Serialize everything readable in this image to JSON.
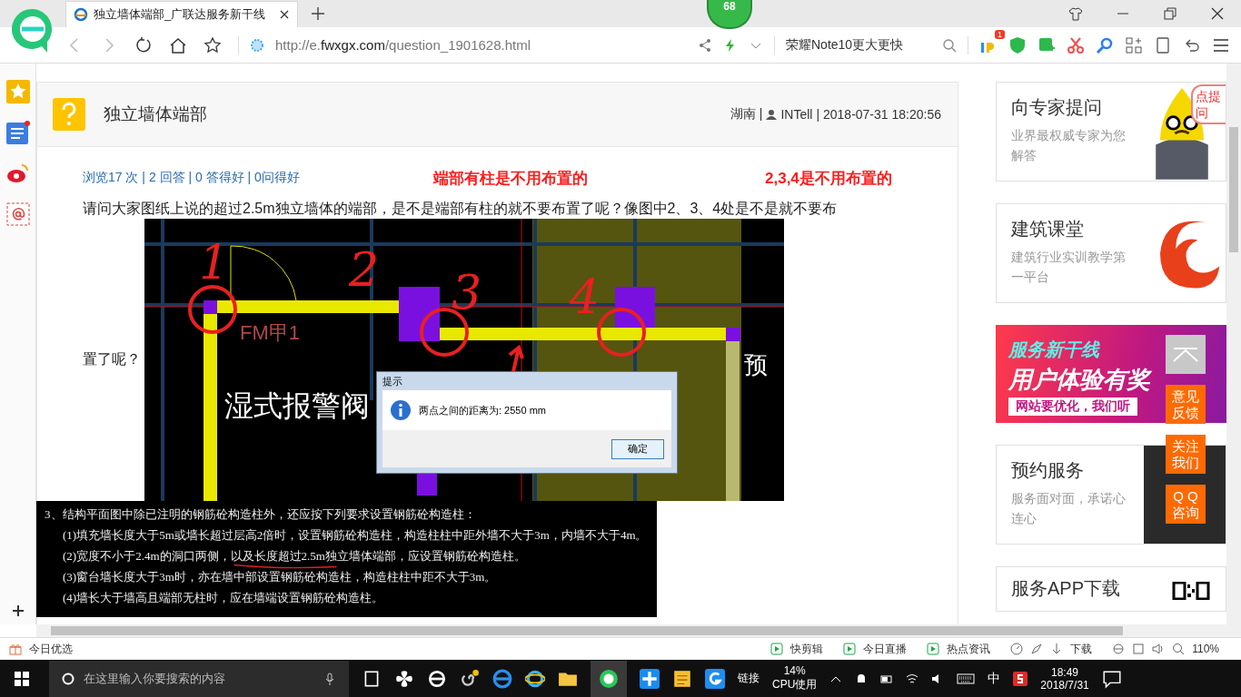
{
  "browser": {
    "badge": "68",
    "tab_title": "独立墙体端部_广联达服务新干线",
    "url_prefix": "http://e.",
    "url_domain": "fwxgx.com",
    "url_path": "/question_1901628.html",
    "search_text": "荣耀Note10更大更快",
    "notification_count": "1"
  },
  "question": {
    "title": "独立墙体端部",
    "location": "湖南 |",
    "user": "INTell",
    "time": "| 2018-07-31 18:20:56",
    "stats": "浏览17 次 | 2 回答 | 0 答得好 | 0问得好",
    "notes": [
      "端部有柱是不用布置的",
      "2,3,4是不用布置的"
    ],
    "text": [
      "请问大家图纸上说的超过2.5m独立墙体的端部，是不是端部有柱的就不要布置了呢？像图中2、3、4处是不是就不要布",
      "置了呢？"
    ],
    "cad": {
      "marks": [
        "1",
        "2",
        "3",
        "4"
      ],
      "labels": [
        "FM甲1",
        "湿式报警阀",
        "预"
      ],
      "dialog": {
        "title": "提示",
        "message": "两点之间的距离为: 2550 mm",
        "button": "确定"
      }
    },
    "spec_lines": [
      "3、结构平面图中除已注明的钢筋砼构造柱外，还应按下列要求设置钢筋砼构造柱：",
      "(1)填充墙长度大于5m或墙长超过层高2倍时，设置钢筋砼构造柱，构造柱柱中距外墙不大于3m，内墙不大于4m。",
      "(2)宽度不小于2.4m的洞口两侧，以及长度超过2.5m独立墙体端部，应设置钢筋砼构造柱。",
      "(3)窗台墙长度大于3m时，亦在墙中部设置钢筋砼构造柱，构造柱柱中距不大于3m。",
      "(4)墙长大于墙高且端部无柱时，应在墙端设置钢筋砼构造柱。"
    ]
  },
  "right_column": {
    "cards": [
      {
        "kind": "mascot",
        "title": "向专家提问",
        "subtitle": "业界最权威专家为您解答",
        "bubble": "点提问"
      },
      {
        "kind": "logo",
        "title": "建筑课堂",
        "subtitle": "建筑行业实训教学第一平台"
      },
      {
        "kind": "banner",
        "title": "服务新干线",
        "subtitle": "用户体验有奖",
        "bubble": "网站要优化，我们听"
      },
      {
        "kind": "photo",
        "title": "预约服务",
        "subtitle": "服务面对面，承诺心连心"
      },
      {
        "kind": "qr",
        "title": "服务APP下载"
      }
    ]
  },
  "float_buttons": [
    {
      "kind": "top"
    },
    {
      "kind": "text",
      "label": "意见反馈"
    },
    {
      "kind": "text",
      "label": "关注我们"
    },
    {
      "kind": "text",
      "label": "Q Q咨询"
    }
  ],
  "status_bar": {
    "left": "今日优选",
    "items": [
      "快剪辑",
      "今日直播",
      "热点资讯"
    ],
    "download": "下载",
    "zoom": "110%"
  },
  "taskbar": {
    "search_placeholder": "在这里输入你要搜索的内容",
    "links": "链接",
    "cpu_value": "14%",
    "cpu_label": "CPU使用",
    "ime": "中",
    "time": "18:49",
    "date": "2018/7/31"
  }
}
